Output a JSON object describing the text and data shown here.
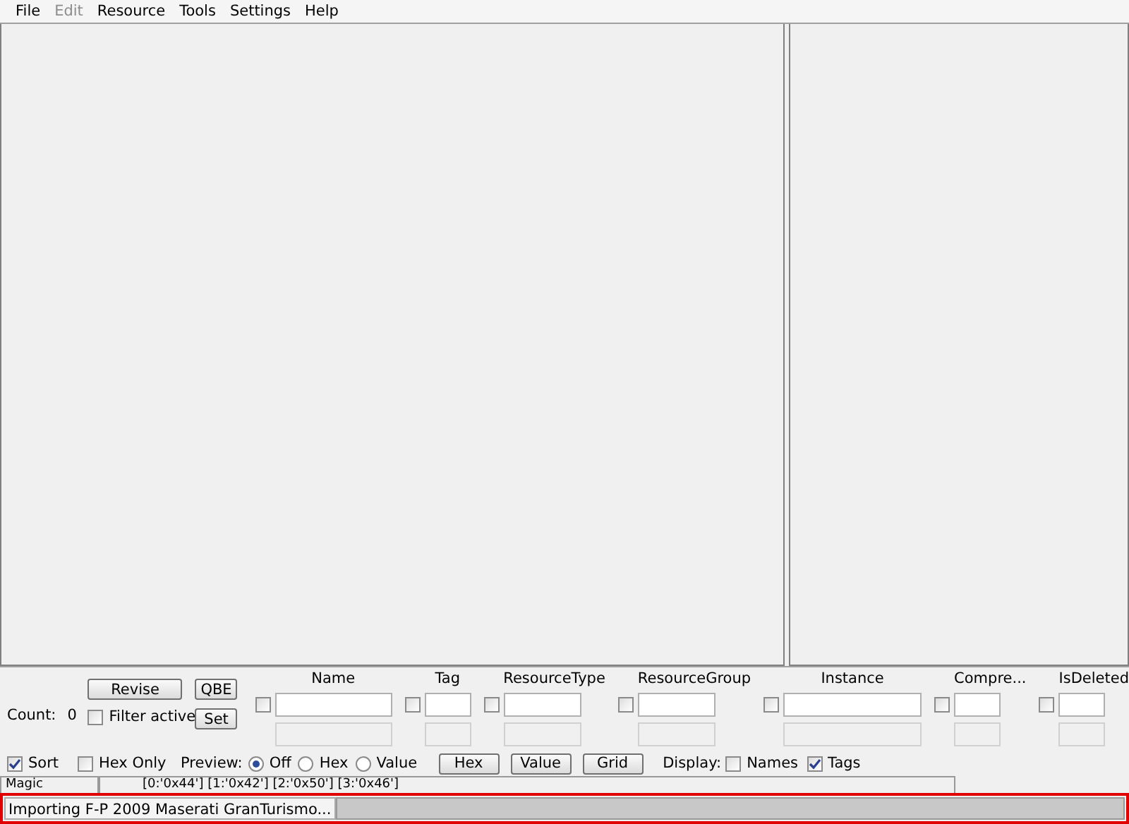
{
  "menu": [
    {
      "label": "File",
      "disabled": false
    },
    {
      "label": "Edit",
      "disabled": true
    },
    {
      "label": "Resource",
      "disabled": false
    },
    {
      "label": "Tools",
      "disabled": false
    },
    {
      "label": "Settings",
      "disabled": false
    },
    {
      "label": "Help",
      "disabled": false
    }
  ],
  "filter": {
    "count_label": "Count:",
    "count": "0",
    "revise": "Revise",
    "qbe": "QBE",
    "set": "Set",
    "filter_active": {
      "label": "Filter active",
      "checked": false
    },
    "columns": [
      {
        "label": "Name",
        "checked": false
      },
      {
        "label": "Tag",
        "checked": false
      },
      {
        "label": "ResourceType",
        "checked": false
      },
      {
        "label": "ResourceGroup",
        "checked": false
      },
      {
        "label": "Instance",
        "checked": false
      },
      {
        "label": "Compre...",
        "checked": false
      },
      {
        "label": "IsDeleted",
        "checked": false
      }
    ]
  },
  "options": {
    "sort": {
      "label": "Sort",
      "checked": true
    },
    "hex_only": {
      "label": "Hex Only",
      "checked": false
    },
    "preview_label": "Preview:",
    "preview": [
      {
        "label": "Off",
        "selected": true
      },
      {
        "label": "Hex",
        "selected": false
      },
      {
        "label": "Value",
        "selected": false
      }
    ],
    "buttons": [
      "Hex",
      "Value",
      "Grid"
    ],
    "display_label": "Display:",
    "display": [
      {
        "label": "Names",
        "checked": false
      },
      {
        "label": "Tags",
        "checked": true
      }
    ]
  },
  "detail": {
    "name": "Magic",
    "value": "[0:'0x44'] [1:'0x42'] [2:'0x50'] [3:'0x46']"
  },
  "status": {
    "text": "Importing F-P 2009 Maserati GranTurismo...",
    "level": 0
  }
}
